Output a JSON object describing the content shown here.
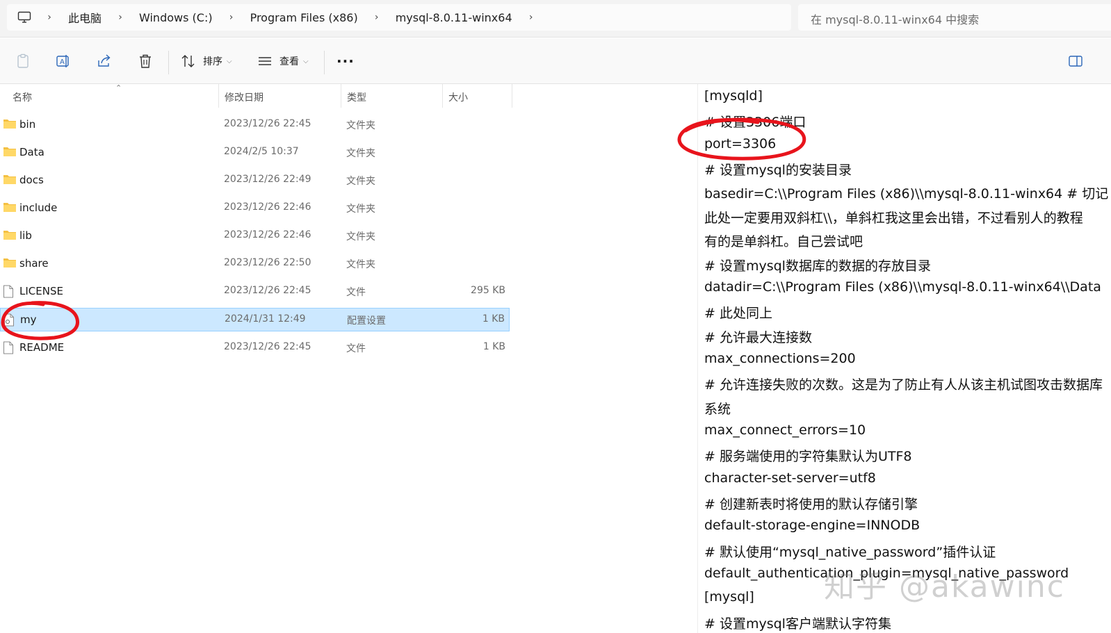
{
  "address_bar": {
    "crumbs": [
      "此电脑",
      "Windows (C:)",
      "Program Files (x86)",
      "mysql-8.0.11-winx64"
    ],
    "search_placeholder": "在 mysql-8.0.11-winx64 中搜索"
  },
  "toolbar": {
    "sort_label": "排序",
    "view_label": "查看",
    "more_label": "···"
  },
  "columns": {
    "name": "名称",
    "modified": "修改日期",
    "type": "类型",
    "size": "大小"
  },
  "files": [
    {
      "name": "bin",
      "date": "2023/12/26 22:45",
      "type": "文件夹",
      "size": "",
      "kind": "folder"
    },
    {
      "name": "Data",
      "date": "2024/2/5 10:37",
      "type": "文件夹",
      "size": "",
      "kind": "folder"
    },
    {
      "name": "docs",
      "date": "2023/12/26 22:49",
      "type": "文件夹",
      "size": "",
      "kind": "folder"
    },
    {
      "name": "include",
      "date": "2023/12/26 22:46",
      "type": "文件夹",
      "size": "",
      "kind": "folder"
    },
    {
      "name": "lib",
      "date": "2023/12/26 22:46",
      "type": "文件夹",
      "size": "",
      "kind": "folder"
    },
    {
      "name": "share",
      "date": "2023/12/26 22:50",
      "type": "文件夹",
      "size": "",
      "kind": "folder"
    },
    {
      "name": "LICENSE",
      "date": "2023/12/26 22:45",
      "type": "文件",
      "size": "295 KB",
      "kind": "file"
    },
    {
      "name": "my",
      "date": "2024/1/31 12:49",
      "type": "配置设置",
      "size": "1 KB",
      "kind": "config",
      "selected": true
    },
    {
      "name": "README",
      "date": "2023/12/26 22:45",
      "type": "文件",
      "size": "1 KB",
      "kind": "file"
    }
  ],
  "config_lines": [
    "[mysqld]",
    "# 设置3306端口",
    "port=3306",
    "# 设置mysql的安装目录",
    "basedir=C:\\\\Program Files (x86)\\\\mysql-8.0.11-winx64   # 切记",
    "此处一定要用双斜杠\\\\，单斜杠我这里会出错，不过看别人的教程",
    "有的是单斜杠。自己尝试吧",
    "# 设置mysql数据库的数据的存放目录",
    "datadir=C:\\\\Program Files (x86)\\\\mysql-8.0.11-winx64\\\\Data",
    "# 此处同上",
    "# 允许最大连接数",
    "max_connections=200",
    "# 允许连接失败的次数。这是为了防止有人从该主机试图攻击数据库",
    "系统",
    "max_connect_errors=10",
    "# 服务端使用的字符集默认为UTF8",
    "character-set-server=utf8",
    "# 创建新表时将使用的默认存储引擎",
    "default-storage-engine=INNODB",
    "# 默认使用“mysql_native_password”插件认证",
    "default_authentication_plugin=mysql_native_password",
    "[mysql]",
    "# 设置mysql客户端默认字符集"
  ],
  "watermark": "知乎 @akawinc",
  "colors": {
    "selection_bg": "#cce8ff",
    "folder_yellow": "#f4c042",
    "annotation_red": "#e8141c"
  }
}
